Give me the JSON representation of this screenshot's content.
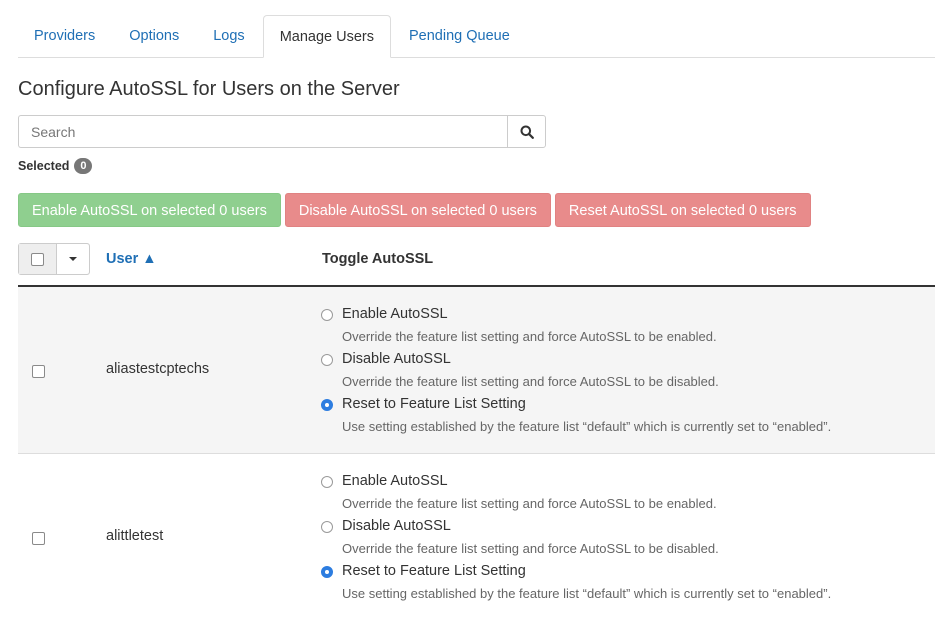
{
  "tabs": [
    {
      "label": "Providers",
      "active": false
    },
    {
      "label": "Options",
      "active": false
    },
    {
      "label": "Logs",
      "active": false
    },
    {
      "label": "Manage Users",
      "active": true
    },
    {
      "label": "Pending Queue",
      "active": false
    }
  ],
  "heading": "Configure AutoSSL for Users on the Server",
  "search": {
    "placeholder": "Search",
    "value": "",
    "button_icon": "search-icon"
  },
  "selected": {
    "label": "Selected",
    "count": "0"
  },
  "actions": {
    "enable_label": "Enable AutoSSL on selected 0 users",
    "disable_label": "Disable AutoSSL on selected 0 users",
    "reset_label": "Reset AutoSSL on selected 0 users"
  },
  "colors": {
    "link": "#1f6fb5",
    "enable_button": "#8fcf8f",
    "disable_button": "#e88b8b",
    "radio_checked": "#2d7de0"
  },
  "table": {
    "col_user": "User ▲",
    "col_toggle": "Toggle AutoSSL",
    "rows": [
      {
        "user": "aliastestcptechs",
        "options": [
          {
            "label": "Enable AutoSSL",
            "desc": "Override the feature list setting and force AutoSSL to be enabled.",
            "checked": false
          },
          {
            "label": "Disable AutoSSL",
            "desc": "Override the feature list setting and force AutoSSL to be disabled.",
            "checked": false
          },
          {
            "label": "Reset to Feature List Setting",
            "desc": "Use setting established by the feature list “default” which is currently set to “enabled”.",
            "checked": true
          }
        ]
      },
      {
        "user": "alittletest",
        "options": [
          {
            "label": "Enable AutoSSL",
            "desc": "Override the feature list setting and force AutoSSL to be enabled.",
            "checked": false
          },
          {
            "label": "Disable AutoSSL",
            "desc": "Override the feature list setting and force AutoSSL to be disabled.",
            "checked": false
          },
          {
            "label": "Reset to Feature List Setting",
            "desc": "Use setting established by the feature list “default” which is currently set to “enabled”.",
            "checked": true
          }
        ]
      }
    ]
  }
}
